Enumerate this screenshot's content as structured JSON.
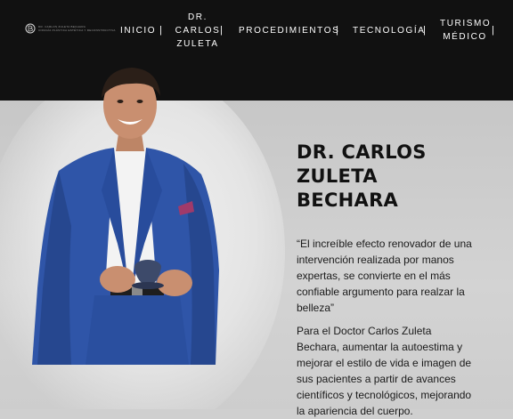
{
  "logo": {
    "line1": "DR. CARLOS ZULETA BECHARA",
    "line2": "CIRUGÍA PLÁSTICA ESTÉTICA Y RECONSTRUCTIVA"
  },
  "nav": {
    "items": [
      {
        "label": "INICIO"
      },
      {
        "label_lines": [
          "DR.",
          "CARLOS",
          "ZULETA"
        ]
      },
      {
        "label": "PROCEDIMIENTOS"
      },
      {
        "label": "TECNOLOGÍA"
      },
      {
        "label_lines": [
          "TURISMO",
          "MÉDICO"
        ]
      }
    ],
    "separator": "|"
  },
  "hero": {
    "name_lines": [
      "DR. CARLOS",
      "ZULETA",
      "BECHARA"
    ],
    "quote": "“El increíble efecto renovador de una intervención realizada por manos expertas, se convierte en el más confiable argumento para realzar la belleza”",
    "body": "Para el Doctor Carlos Zuleta Bechara, aumentar la autoestima y mejorar el estilo de vida e imagen de sus pacientes a partir de avances científicos y tecnológicos, mejorando la apariencia del cuerpo."
  },
  "colors": {
    "header_bg": "#111111",
    "hero_bg": "#cfcfcf",
    "suit_blue": "#2f55a8",
    "text_dark": "#111111"
  }
}
